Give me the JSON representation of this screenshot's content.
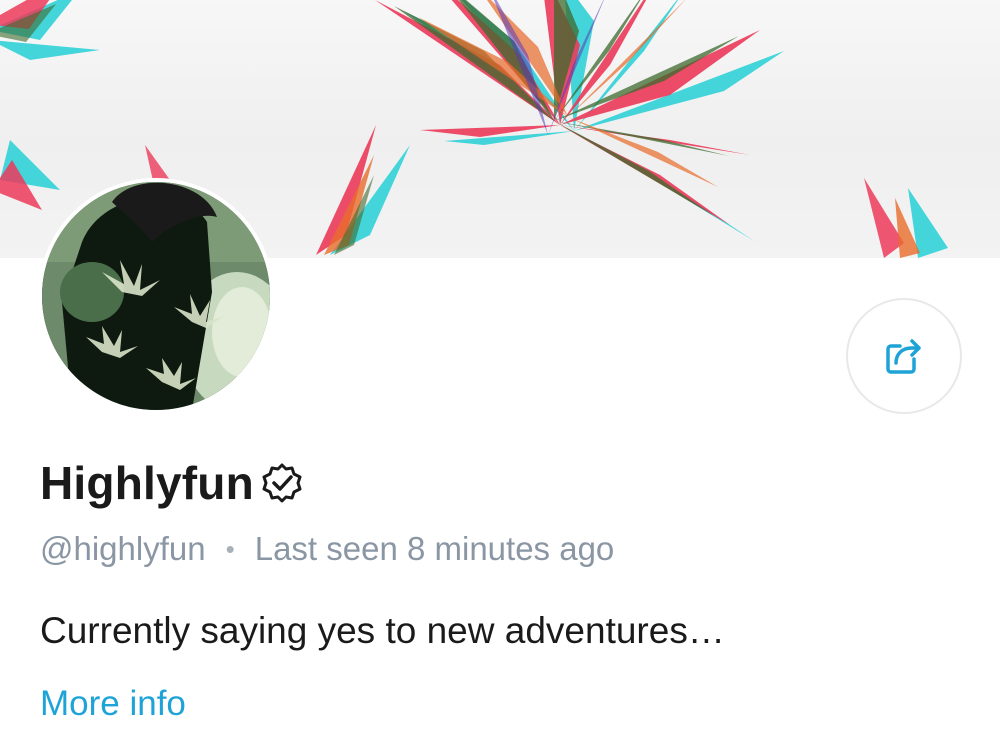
{
  "profile": {
    "display_name": "Highlyfun",
    "username": "@highlyfun",
    "separator": "•",
    "last_seen": "Last seen 8 minutes ago",
    "bio": "Currently saying yes to new adventures…",
    "more_info_label": "More info",
    "verified": true
  },
  "icons": {
    "share": "share-icon",
    "verified": "verified-badge-icon"
  },
  "colors": {
    "link": "#1ea3d6",
    "muted": "#8a96a3",
    "text": "#1a1a1a",
    "border": "#e6e8ea"
  }
}
